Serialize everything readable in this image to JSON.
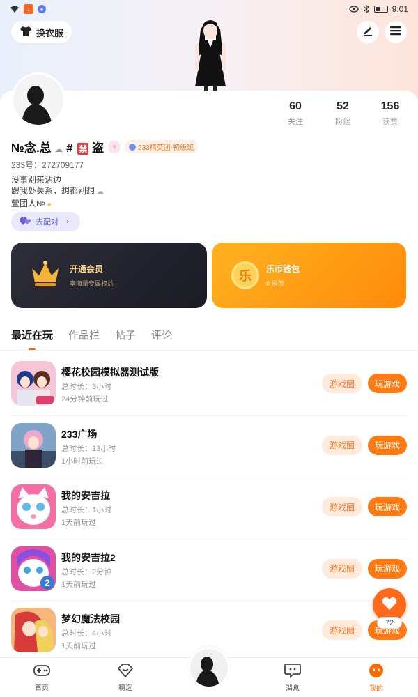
{
  "statusbar": {
    "time": "9:01"
  },
  "header": {
    "outfit_label": "换衣服"
  },
  "profile": {
    "stats": [
      {
        "value": "60",
        "label": "关注"
      },
      {
        "value": "52",
        "label": "粉丝"
      },
      {
        "value": "156",
        "label": "获赞"
      }
    ],
    "name_part1": "№念.总",
    "name_part2": "#",
    "ban_char": "禁",
    "name_part3": "盗",
    "club_tag": "233精英团-初级班",
    "uid": "233号：272709177",
    "bio_lines": [
      "没事别来沾边",
      "跟我处关系，想都别想",
      "萱团人№"
    ],
    "pair_label": "去配对"
  },
  "cards": {
    "vip_title": "开通会员",
    "vip_sub": "享海量专属权益",
    "wallet_title": "乐币钱包",
    "wallet_sub": "0 乐币",
    "coin_char": "乐"
  },
  "tabs": [
    "最近在玩",
    "作品栏",
    "帖子",
    "评论"
  ],
  "games": [
    {
      "name": "樱花校园模拟器测试版",
      "duration": "总时长：3小时",
      "last": "24分钟前玩过"
    },
    {
      "name": "233广场",
      "duration": "总时长：13小时",
      "last": "1小时前玩过"
    },
    {
      "name": "我的安吉拉",
      "duration": "总时长：1小时",
      "last": "1天前玩过"
    },
    {
      "name": "我的安吉拉2",
      "duration": "总时长：2分钟",
      "last": "1天前玩过"
    },
    {
      "name": "梦幻魔法校园",
      "duration": "总时长：4小时",
      "last": "1天前玩过"
    }
  ],
  "buttons": {
    "circle": "游戏圈",
    "play": "玩游戏"
  },
  "fab": {
    "count": "72"
  },
  "nav": [
    {
      "label": "首页"
    },
    {
      "label": "精选"
    },
    {
      "label": "消息"
    },
    {
      "label": "我的"
    }
  ],
  "colors": {
    "accent": "#ff6a00",
    "play_button": "#ff7a12",
    "circle_button_bg": "#ffeadb"
  }
}
